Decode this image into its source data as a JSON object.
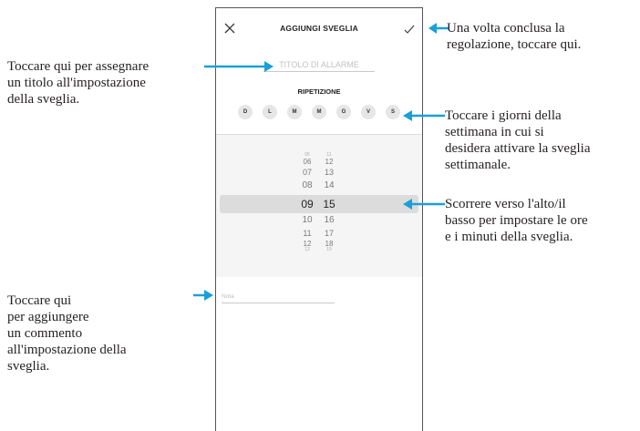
{
  "phone": {
    "title": "AGGIUNGI SVEGLIA",
    "alarm_title_placeholder": "TITOLO DI ALLARME",
    "repeat_label": "RIPETIZIONE",
    "days": [
      "D",
      "L",
      "M",
      "M",
      "G",
      "V",
      "S"
    ],
    "hours": [
      "05",
      "06",
      "07",
      "08",
      "09",
      "10",
      "11",
      "12",
      "13"
    ],
    "minutes": [
      "11",
      "12",
      "13",
      "14",
      "15",
      "16",
      "17",
      "18",
      "19"
    ],
    "selected_hour": "09",
    "selected_minute": "15",
    "note_placeholder": "Nota"
  },
  "callouts": {
    "confirm": [
      "Una volta conclusa la",
      "regolazione, toccare qui."
    ],
    "title": [
      "Toccare qui per assegnare",
      "un titolo all'impostazione",
      "della sveglia."
    ],
    "days": [
      "Toccare i giorni della",
      "settimana in cui si",
      "desidera attivare la sveglia",
      "settimanale."
    ],
    "scroll": [
      "Scorrere verso l'alto/il",
      "basso per impostare le ore",
      "e i minuti della sveglia."
    ],
    "note": [
      "Toccare qui",
      "per aggiungere",
      "un commento",
      "all'impostazione della",
      "sveglia."
    ]
  },
  "colors": {
    "arrow": "#1a9fd9",
    "band": "#dcdcdc",
    "day_bg": "#e6e6e6"
  }
}
